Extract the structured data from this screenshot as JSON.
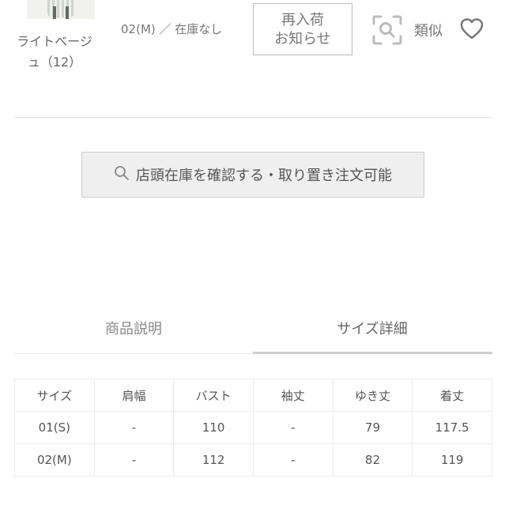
{
  "variant": {
    "color_name": "ライトベージュ（12）",
    "size_stock": "02(M) ／ 在庫なし"
  },
  "actions": {
    "restock_line1": "再入荷",
    "restock_line2": "お知らせ",
    "similar_label": "類似"
  },
  "store_button": {
    "label": "店頭在庫を確認する・取り置き注文可能"
  },
  "tabs": [
    {
      "label": "商品説明"
    },
    {
      "label": "サイズ詳細"
    }
  ],
  "size_table": {
    "headers": [
      "サイズ",
      "肩幅",
      "バスト",
      "袖丈",
      "ゆき丈",
      "着丈"
    ],
    "rows": [
      [
        "01(S)",
        "-",
        "110",
        "-",
        "79",
        "117.5"
      ],
      [
        "02(M)",
        "-",
        "112",
        "-",
        "82",
        "119"
      ]
    ]
  },
  "icons": {
    "image_search": "image-search-icon",
    "favorite": "heart-icon",
    "search": "search-icon"
  }
}
